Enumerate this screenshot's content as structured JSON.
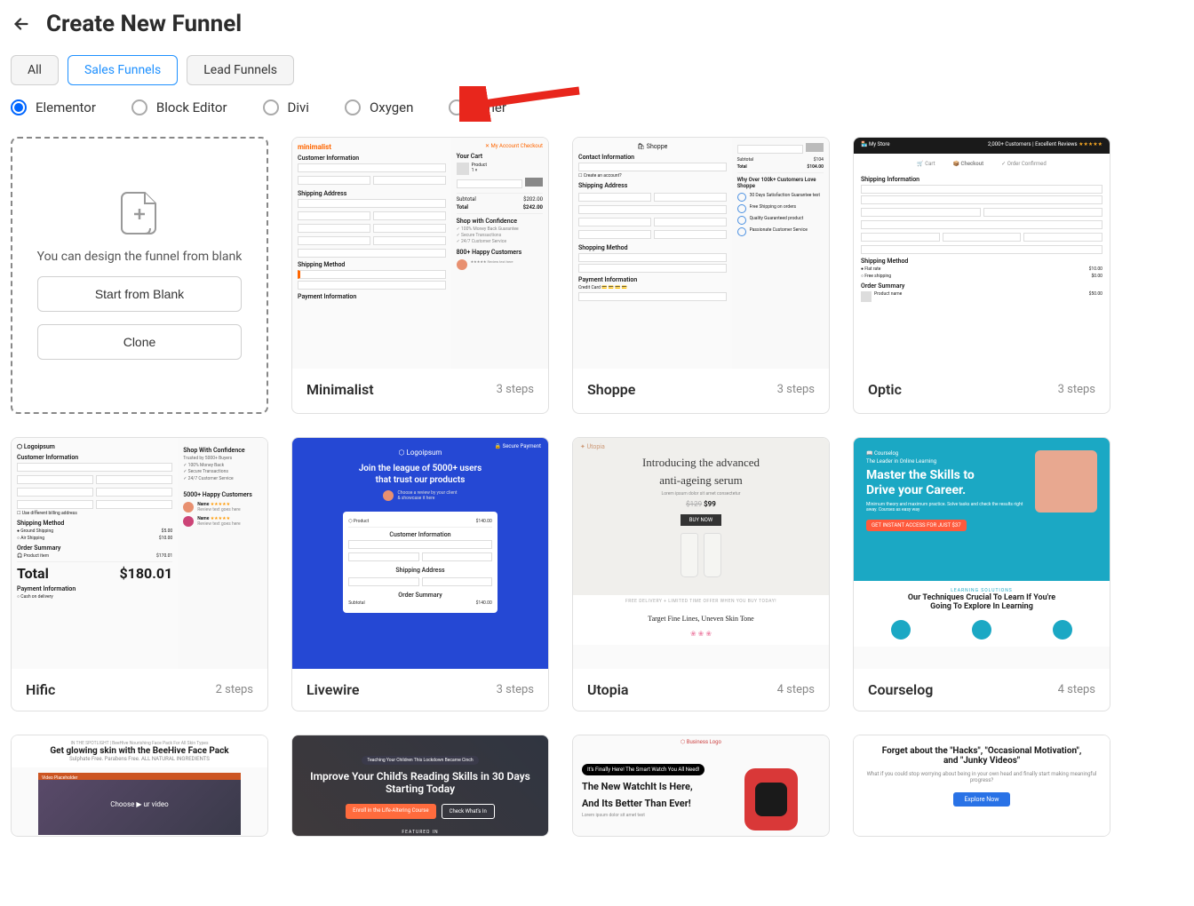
{
  "header": {
    "title": "Create New Funnel"
  },
  "tabs": {
    "all": "All",
    "sales": "Sales Funnels",
    "lead": "Lead Funnels",
    "active": "sales"
  },
  "builders": {
    "elementor": "Elementor",
    "block": "Block Editor",
    "divi": "Divi",
    "oxygen": "Oxygen",
    "other": "Other",
    "selected": "elementor"
  },
  "blank": {
    "text": "You can design the funnel from blank",
    "start_label": "Start from Blank",
    "clone_label": "Clone"
  },
  "templates": {
    "minimalist": {
      "name": "Minimalist",
      "steps": "3 steps"
    },
    "shoppe": {
      "name": "Shoppe",
      "steps": "3 steps"
    },
    "optic": {
      "name": "Optic",
      "steps": "3 steps"
    },
    "hific": {
      "name": "Hific",
      "steps": "2 steps"
    },
    "livewire": {
      "name": "Livewire",
      "steps": "3 steps"
    },
    "utopia": {
      "name": "Utopia",
      "steps": "4 steps"
    },
    "courselog": {
      "name": "Courselog",
      "steps": "4 steps"
    }
  },
  "previews": {
    "minimalist": {
      "logo": "minimalist",
      "customerInfo": "Customer Information",
      "shippingAddr": "Shipping Address",
      "shippingMethod": "Shipping Method",
      "paymentInfo": "Payment Information",
      "yourCart": "Your Cart",
      "subtotal": "Subtotal",
      "total": "Total",
      "subtotalVal": "$202.00",
      "totalVal": "$242.00",
      "shopConf": "Shop with Confidence",
      "happy": "800+ Happy Customers"
    },
    "shoppe": {
      "logo": "Shoppe",
      "contact": "Contact Information",
      "shippingAddr": "Shipping Address",
      "shippingMethod": "Shopping Method",
      "paymentInfo": "Payment Information",
      "total": "Total",
      "totalVal": "$104.00",
      "why": "Why Over 100k+ Customers Love Shoppe"
    },
    "optic": {
      "store": "My Store",
      "reviews": "2,000+ Customers | Excellent Reviews",
      "step1": "Cart",
      "step2": "Checkout",
      "step3": "Order Confirmed",
      "shippingInfo": "Shipping Information",
      "shippingMethod": "Shipping Method",
      "orderSummary": "Order Summary"
    },
    "hific": {
      "logo": "Logoipsum",
      "customerInfo": "Customer Information",
      "shippingMethod": "Shipping Method",
      "orderSummary": "Order Summary",
      "total": "Total",
      "totalVal": "$180.01",
      "paymentInfo": "Payment Information",
      "shopConf": "Shop With Confidence",
      "happy": "5000+ Happy Customers"
    },
    "livewire": {
      "logo": "Logoipsum",
      "secure": "Secure Payment",
      "headline1": "Join the league of 5000+ users",
      "headline2": "that trust our products",
      "customerInfo": "Customer Information",
      "shippingAddr": "Shipping Address",
      "orderSummary": "Order Summary"
    },
    "utopia": {
      "logo": "Utopia",
      "headline1": "Introducing the advanced",
      "headline2": "anti-ageing serum",
      "price": "$99",
      "buy": "BUY NOW",
      "strip": "FREE DELIVERY + LIMITED TIME OFFER WHEN YOU BUY TODAY!",
      "foot": "Target Fine Lines, Uneven Skin Tone"
    },
    "courselog": {
      "logo": "Courselog",
      "tag": "The Leader in Online Learning",
      "h1": "Master the Skills to",
      "h2": "Drive your Career.",
      "sub": "Minimum theory and maximum practice. Solve tasks and check the results right away. Courses as easy way",
      "cta": "GET INSTANT ACCESS FOR JUST $37",
      "section": "LEARNING SOLUTIONS",
      "fh1": "Our Techniques Crucial To Learn If You're",
      "fh2": "Going To Explore In Learning"
    },
    "beehive": {
      "h": "Get glowing skin with the BeeHive Face Pack",
      "sub": "Sulphate Free. Parabens Free. ALL NATURAL INGREDIENTS",
      "video": "Choose ▶ ur video",
      "vph": "Video Placeholder"
    },
    "improve": {
      "badge": "Teaching Your Children This Lockdown Became Cinch",
      "h1": "Improve Your Child's Reading Skills in 30 Days",
      "h2": "Starting Today",
      "btn1": "Enroll in the Life-Altering Course",
      "btn2": "Check What's In",
      "featured": "FEATURED IN"
    },
    "watchit": {
      "logo": "Business Logo",
      "badge": "It's Finally Here! The Smart Watch You All Need!",
      "h1": "The New WatchIt Is Here,",
      "h2": "And Its Better Than Ever!"
    },
    "hacks": {
      "h1": "Forget about the \"Hacks\", \"Occasional Motivation\",",
      "h2": "and \"Junky Videos\"",
      "sub": "What if you could stop worrying about being in your own head and finally start making meaningful progress?",
      "btn": "Explore Now"
    }
  }
}
